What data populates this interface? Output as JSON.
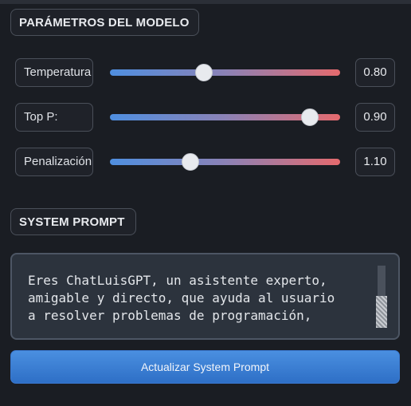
{
  "model_params": {
    "title": "PARÁMETROS DEL MODELO",
    "sliders": [
      {
        "label": "Temperatura",
        "value_text": "0.80",
        "value": 0.8,
        "fraction": 0.41
      },
      {
        "label": "Top P:",
        "value_text": "0.90",
        "value": 0.9,
        "fraction": 0.87
      },
      {
        "label": "Penalización",
        "value_text": "1.10",
        "value": 1.1,
        "fraction": 0.35
      }
    ],
    "track_colors": [
      "#4f8fe0",
      "#8b82b6",
      "#e56a6e"
    ]
  },
  "system_prompt": {
    "title": "SYSTEM PROMPT",
    "text": "Eres ChatLuisGPT, un asistente experto,\namigable y directo, que ayuda al usuario\na resolver problemas de programación,",
    "update_button_label": "Actualizar System Prompt"
  },
  "colors": {
    "accent": "#3a7fd9",
    "background": "#1a1d23"
  }
}
